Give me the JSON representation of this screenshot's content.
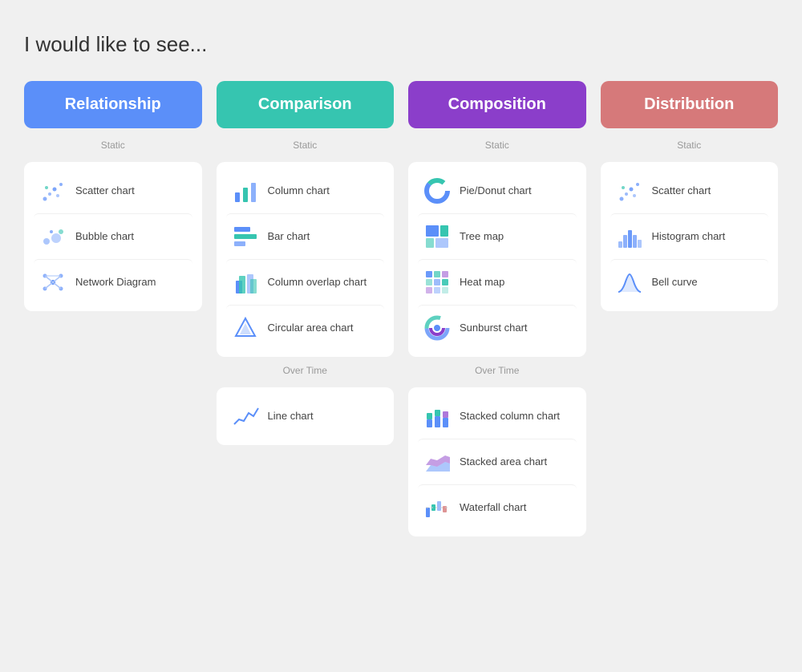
{
  "page": {
    "title": "I would like to see..."
  },
  "columns": [
    {
      "id": "relationship",
      "header": "Relationship",
      "header_class": "relationship-header",
      "sections": [
        {
          "label": "Static",
          "items": [
            {
              "label": "Scatter chart",
              "icon": "scatter"
            },
            {
              "label": "Bubble chart",
              "icon": "bubble"
            },
            {
              "label": "Network Diagram",
              "icon": "network"
            }
          ]
        }
      ]
    },
    {
      "id": "comparison",
      "header": "Comparison",
      "header_class": "comparison-header",
      "sections": [
        {
          "label": "Static",
          "items": [
            {
              "label": "Column chart",
              "icon": "column"
            },
            {
              "label": "Bar chart",
              "icon": "bar"
            },
            {
              "label": "Column overlap chart",
              "icon": "column-overlap"
            },
            {
              "label": "Circular area chart",
              "icon": "circular-area"
            }
          ]
        },
        {
          "label": "Over Time",
          "items": [
            {
              "label": "Line chart",
              "icon": "line"
            }
          ]
        }
      ]
    },
    {
      "id": "composition",
      "header": "Composition",
      "header_class": "composition-header",
      "sections": [
        {
          "label": "Static",
          "items": [
            {
              "label": "Pie/Donut chart",
              "icon": "donut"
            },
            {
              "label": "Tree map",
              "icon": "treemap"
            },
            {
              "label": "Heat map",
              "icon": "heatmap"
            },
            {
              "label": "Sunburst chart",
              "icon": "sunburst"
            }
          ]
        },
        {
          "label": "Over Time",
          "items": [
            {
              "label": "Stacked column chart",
              "icon": "stacked-column"
            },
            {
              "label": "Stacked area chart",
              "icon": "stacked-area"
            },
            {
              "label": "Waterfall chart",
              "icon": "waterfall"
            }
          ]
        }
      ]
    },
    {
      "id": "distribution",
      "header": "Distribution",
      "header_class": "distribution-header",
      "sections": [
        {
          "label": "Static",
          "items": [
            {
              "label": "Scatter chart",
              "icon": "scatter"
            },
            {
              "label": "Histogram chart",
              "icon": "histogram"
            },
            {
              "label": "Bell curve",
              "icon": "bellcurve"
            }
          ]
        }
      ]
    }
  ]
}
